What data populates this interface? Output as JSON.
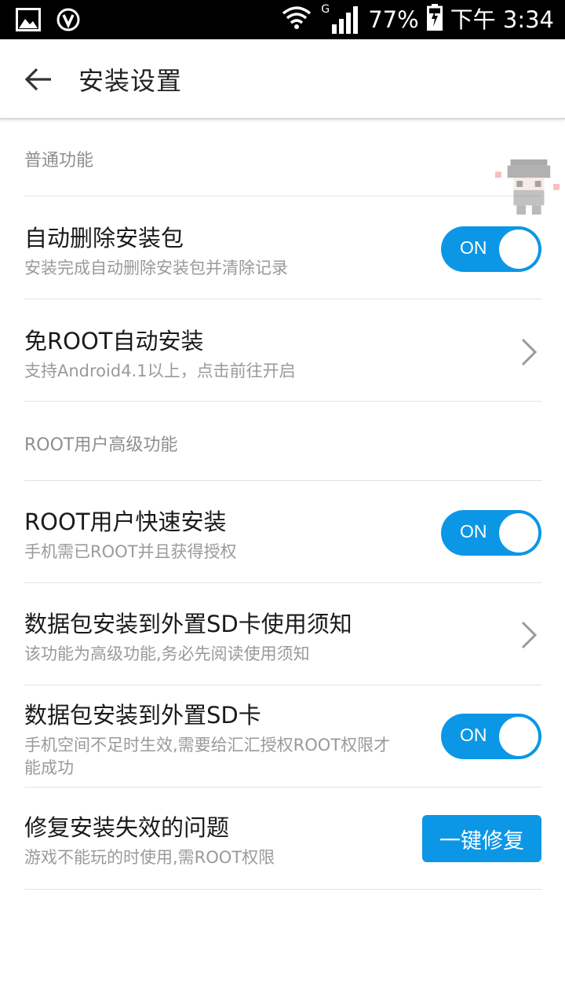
{
  "status_bar": {
    "battery": "77%",
    "time": "下午 3:34",
    "network_type": "G",
    "icons": [
      "gallery-icon",
      "v-app-icon",
      "wifi-icon",
      "signal-icon",
      "battery-charging-icon"
    ]
  },
  "appbar": {
    "title": "安装设置",
    "back_icon": "back-arrow-icon"
  },
  "sections": [
    {
      "header": "普通功能",
      "items": [
        {
          "title": "自动删除安装包",
          "subtitle": "安装完成自动删除安装包并清除记录",
          "control": "toggle",
          "state": "ON"
        },
        {
          "title": "免ROOT自动安装",
          "subtitle": "支持Android4.1以上，点击前往开启",
          "control": "chevron"
        }
      ]
    },
    {
      "header": "ROOT用户高级功能",
      "items": [
        {
          "title": "ROOT用户快速安装",
          "subtitle": "手机需已ROOT并且获得授权",
          "control": "toggle",
          "state": "ON"
        },
        {
          "title": "数据包安装到外置SD卡使用须知",
          "subtitle": "该功能为高级功能,务必先阅读使用须知",
          "control": "chevron"
        },
        {
          "title": "数据包安装到外置SD卡",
          "subtitle_line1": "手机空间不足时生效,需要给汇汇授权ROOT权限才",
          "subtitle_line2": "能成功",
          "control": "toggle",
          "state": "ON"
        },
        {
          "title": "修复安装失效的问题",
          "subtitle": "游戏不能玩的时使用,需ROOT权限",
          "control": "button",
          "button_label": "一键修复"
        }
      ]
    }
  ],
  "colors": {
    "accent": "#0b97e6",
    "title_text": "#1a1a1a",
    "subtitle_text": "#9a9a9a",
    "section_header": "#8e8e8e",
    "divider": "#e2e2e2"
  }
}
